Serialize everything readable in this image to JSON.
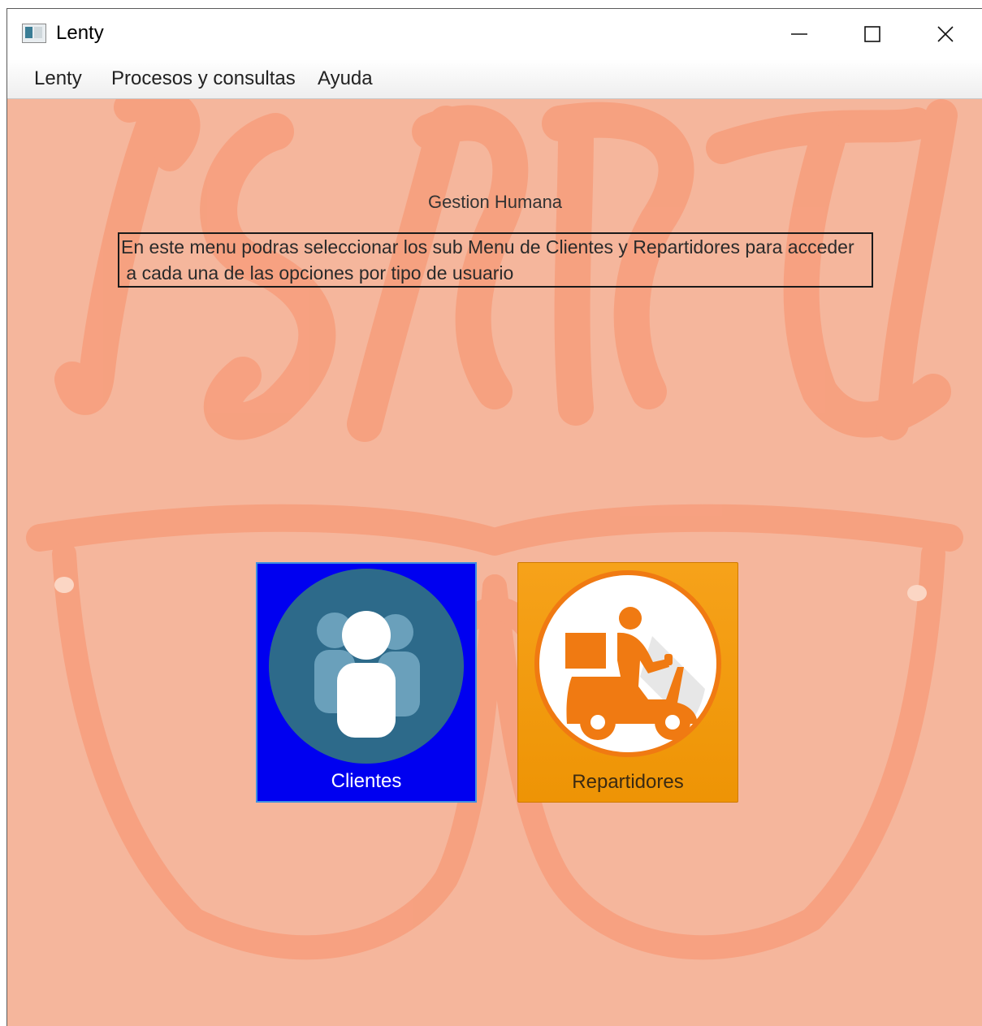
{
  "window": {
    "title": "Lenty"
  },
  "menubar": {
    "items": [
      {
        "label": "Lenty"
      },
      {
        "label": "Procesos y consultas"
      },
      {
        "label": "Ayuda"
      }
    ]
  },
  "main": {
    "heading": "Gestion Humana",
    "description": "En este menu podras seleccionar los sub Menu de Clientes y Repartidores para acceder\n a cada una de las opciones por tipo de usuario",
    "tiles": [
      {
        "label": "Clientes",
        "icon": "users-icon",
        "color": "#0000f0"
      },
      {
        "label": "Repartidores",
        "icon": "delivery-scooter-icon",
        "color": "#f29a0e"
      }
    ]
  },
  "colors": {
    "background": "#f5b69c",
    "watermark": "#f7a07f"
  }
}
